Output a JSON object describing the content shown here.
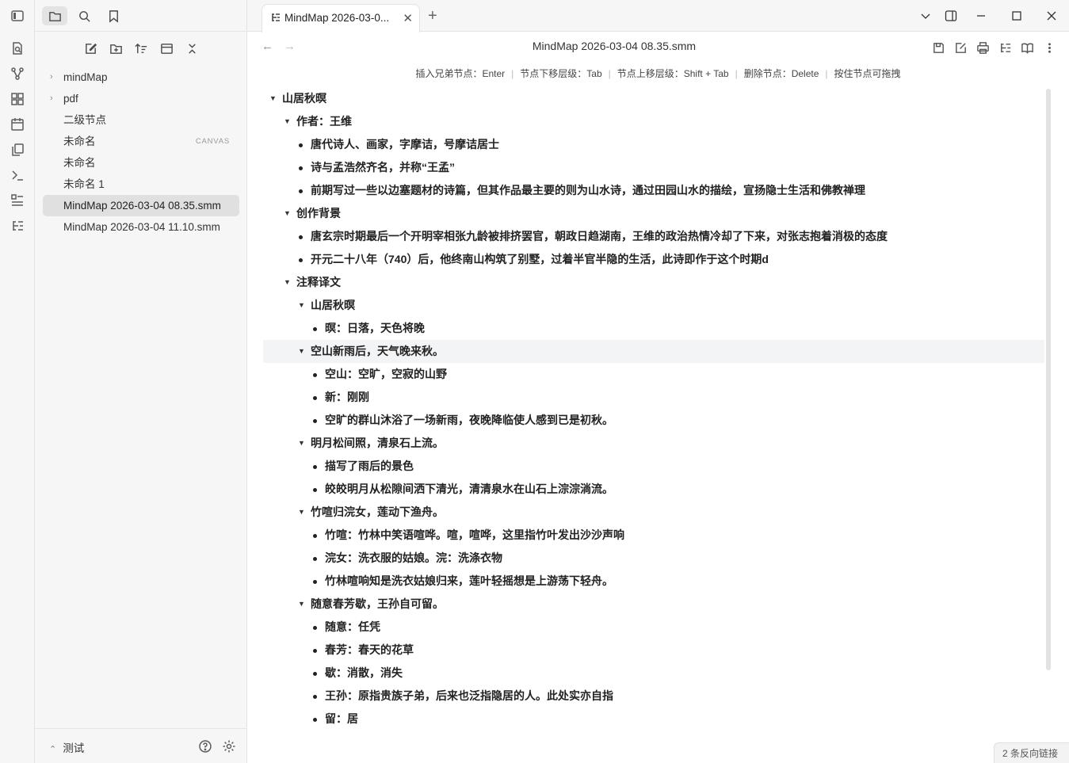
{
  "sidebar": {
    "items": [
      {
        "label": "mindMap",
        "type": "folder"
      },
      {
        "label": "pdf",
        "type": "folder"
      },
      {
        "label": "二级节点",
        "type": "file"
      },
      {
        "label": "未命名",
        "type": "file",
        "badge": "CANVAS"
      },
      {
        "label": "未命名",
        "type": "file"
      },
      {
        "label": "未命名 1",
        "type": "file"
      },
      {
        "label": "MindMap 2026-03-04 08.35.smm",
        "type": "file",
        "active": true
      },
      {
        "label": "MindMap 2026-03-04 11.10.smm",
        "type": "file"
      }
    ],
    "vault_name": "测试"
  },
  "tab": {
    "title": "MindMap 2026-03-0...",
    "new_tab": "+"
  },
  "view": {
    "title": "MindMap 2026-03-04 08.35.smm"
  },
  "hints": [
    "插入兄弟节点：Enter",
    "节点下移层级：Tab",
    "节点上移层级：Shift + Tab",
    "删除节点：Delete",
    "按住节点可拖拽"
  ],
  "outline": [
    {
      "level": 0,
      "text": "山居秋暝",
      "type": "parent"
    },
    {
      "level": 1,
      "text": "作者：王维",
      "type": "parent"
    },
    {
      "level": 2,
      "text": "唐代诗人、画家，字摩诘，号摩诘居士",
      "type": "leaf"
    },
    {
      "level": 2,
      "text": "诗与孟浩然齐名，并称“王孟”",
      "type": "leaf"
    },
    {
      "level": 2,
      "text": "前期写过一些以边塞题材的诗篇，但其作品最主要的则为山水诗，通过田园山水的描绘，宣扬隐士生活和佛教禅理",
      "type": "leaf"
    },
    {
      "level": 1,
      "text": "创作背景",
      "type": "parent"
    },
    {
      "level": 2,
      "text": "唐玄宗时期最后一个开明宰相张九龄被排挤罢官，朝政日趋湖南，王维的政治热情冷却了下来，对张志抱着消极的态度",
      "type": "leaf"
    },
    {
      "level": 2,
      "text": "开元二十八年（740）后，他终南山构筑了别墅，过着半官半隐的生活，此诗即作于这个时期d",
      "type": "leaf"
    },
    {
      "level": 1,
      "text": "注释译文",
      "type": "parent"
    },
    {
      "level": 2,
      "text": "山居秋暝",
      "type": "parent"
    },
    {
      "level": 3,
      "text": "暝：日落，天色将晚",
      "type": "leaf"
    },
    {
      "level": 2,
      "text": "空山新雨后，天气晚来秋。",
      "type": "parent",
      "highlight": true
    },
    {
      "level": 3,
      "text": "空山：空旷，空寂的山野",
      "type": "leaf"
    },
    {
      "level": 3,
      "text": "新：刚刚",
      "type": "leaf"
    },
    {
      "level": 3,
      "text": "空旷的群山沐浴了一场新雨，夜晚降临使人感到已是初秋。",
      "type": "leaf"
    },
    {
      "level": 2,
      "text": "明月松间照，清泉石上流。",
      "type": "parent"
    },
    {
      "level": 3,
      "text": "描写了雨后的景色",
      "type": "leaf"
    },
    {
      "level": 3,
      "text": "皎皎明月从松隙间洒下清光，清清泉水在山石上淙淙淌流。",
      "type": "leaf"
    },
    {
      "level": 2,
      "text": "竹喧归浣女，莲动下渔舟。",
      "type": "parent"
    },
    {
      "level": 3,
      "text": "竹喧：竹林中笑语喧哗。喧，喧哗，这里指竹叶发出沙沙声响",
      "type": "leaf"
    },
    {
      "level": 3,
      "text": "浣女：洗衣服的姑娘。浣：洗涤衣物",
      "type": "leaf"
    },
    {
      "level": 3,
      "text": "竹林喧响知是洗衣姑娘归来，莲叶轻摇想是上游荡下轻舟。",
      "type": "leaf"
    },
    {
      "level": 2,
      "text": "随意春芳歇，王孙自可留。",
      "type": "parent"
    },
    {
      "level": 3,
      "text": "随意：任凭",
      "type": "leaf"
    },
    {
      "level": 3,
      "text": "春芳：春天的花草",
      "type": "leaf"
    },
    {
      "level": 3,
      "text": "歇：消散，消失",
      "type": "leaf"
    },
    {
      "level": 3,
      "text": "王孙：原指贵族子弟，后来也泛指隐居的人。此处实亦自指",
      "type": "leaf"
    },
    {
      "level": 3,
      "text": "留：居",
      "type": "leaf"
    }
  ],
  "status": {
    "backlinks": "2 条反向链接"
  }
}
